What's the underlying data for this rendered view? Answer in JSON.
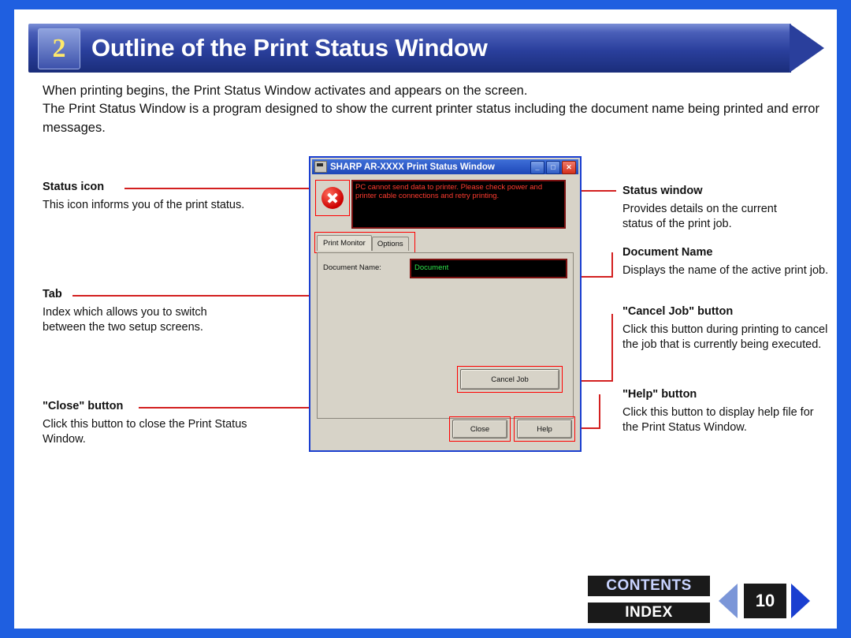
{
  "header": {
    "number": "2",
    "title": "Outline of the Print Status Window"
  },
  "intro": {
    "line1": "When printing begins, the Print Status Window activates and appears on the screen.",
    "line2": "The Print Status Window is a program designed to show the current printer status including the document name being printed and error messages."
  },
  "dialog": {
    "title": "SHARP AR-XXXX Print Status Window",
    "window_buttons": {
      "minimize": "_",
      "maximize": "□",
      "close": "✕"
    },
    "status_icon": "error-x-icon",
    "status_message": "PC cannot send data to printer. Please check power and printer cable connections and retry printing.",
    "tabs": [
      {
        "label": "Print Monitor",
        "active": true
      },
      {
        "label": "Options",
        "active": false
      }
    ],
    "document_name_label": "Document Name:",
    "document_name_value": "Document",
    "cancel_job_button": "Cancel Job",
    "close_button": "Close",
    "help_button": "Help"
  },
  "callouts": {
    "status_icon": {
      "heading": "Status icon",
      "body": "This icon informs you of the print status."
    },
    "tab": {
      "heading": "Tab",
      "body": "Index which allows you to switch between the two setup screens."
    },
    "close_button": {
      "heading": "\"Close\" button",
      "body": "Click this button to close the Print Status Window."
    },
    "status_window": {
      "heading": "Status window",
      "body": "Provides details on the current status of the print job."
    },
    "document_name": {
      "heading": "Document Name",
      "body": "Displays the name of the active print job."
    },
    "cancel_job": {
      "heading": "\"Cancel Job\" button",
      "body": "Click this button during printing to cancel the job that is currently being executed."
    },
    "help_button": {
      "heading": "\"Help\" button",
      "body": "Click this button to display help file for the Print Status Window."
    }
  },
  "footer": {
    "contents_label": "CONTENTS",
    "index_label": "INDEX",
    "page_number": "10",
    "prev_icon": "triangle-left-icon",
    "next_icon": "triangle-right-icon"
  },
  "colors": {
    "page_background": "#1f5fe0",
    "banner_gradient_start": "#7b8fd6",
    "banner_gradient_end": "#1a2d7a",
    "banner_number": "#ffe96b",
    "leader_line": "#d32020",
    "status_text": "#ff3b2f",
    "document_text": "#2ee34a"
  }
}
